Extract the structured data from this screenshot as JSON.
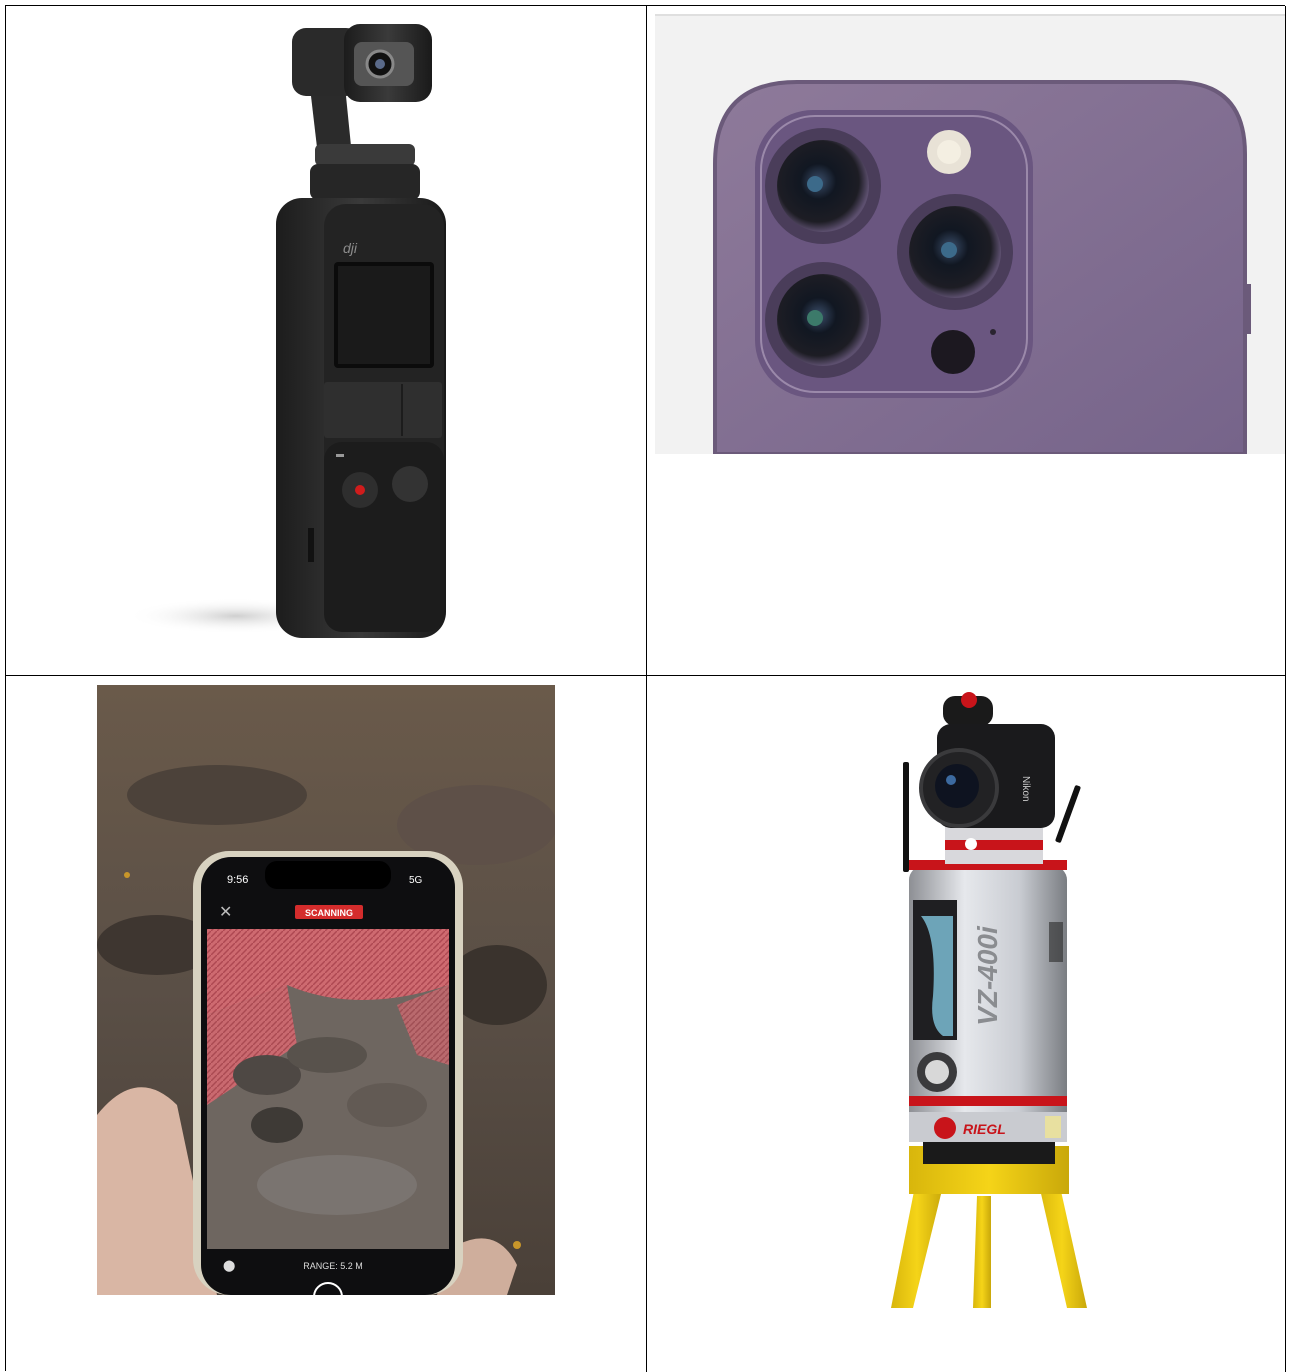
{
  "images": [
    {
      "subject": "pocket gimbal camera",
      "brand_text": "dji"
    },
    {
      "subject": "smartphone triple camera module"
    },
    {
      "subject": "phone app scanning terrain",
      "status_label": "SCANNING",
      "clock": "9:56",
      "network": "5G",
      "range_label": "RANGE: 5.2 M"
    },
    {
      "subject": "terrestrial laser scanner on tripod",
      "model_text": "VZ-400i",
      "brand_text": "RIEGL",
      "camera_brand": "Nikon"
    }
  ]
}
